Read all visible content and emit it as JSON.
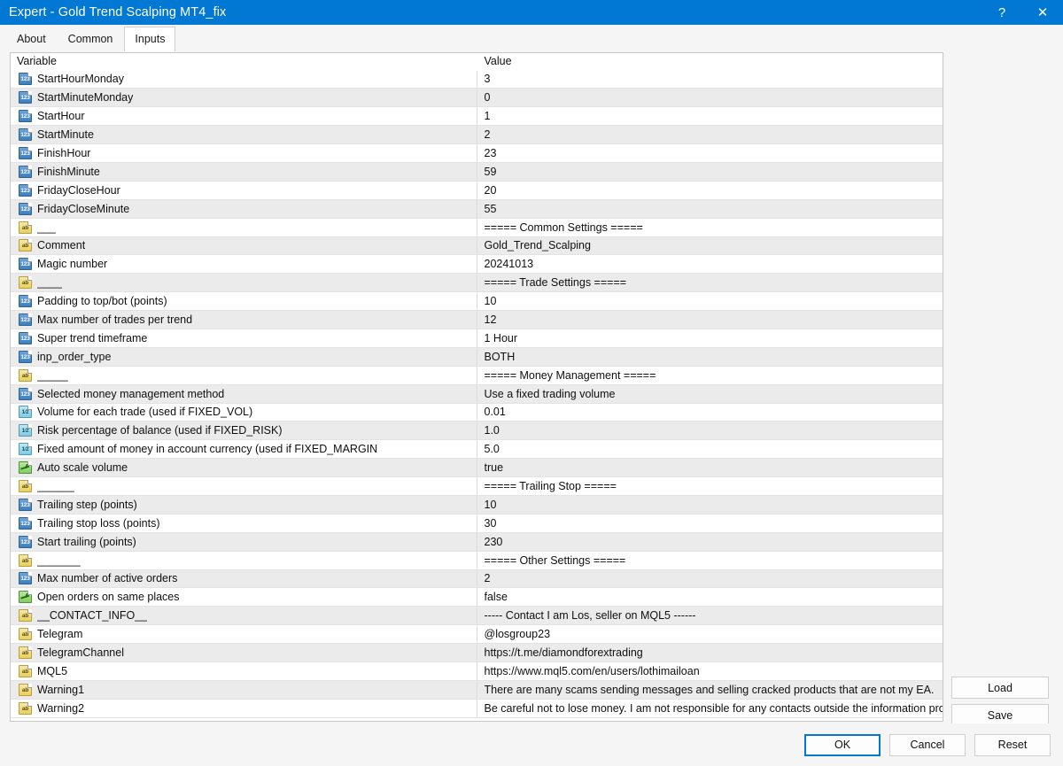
{
  "window": {
    "title": "Expert - Gold Trend Scalping MT4_fix",
    "help_label": "?",
    "close_label": "✕"
  },
  "tabs": [
    {
      "label": "About",
      "active": false
    },
    {
      "label": "Common",
      "active": false
    },
    {
      "label": "Inputs",
      "active": true
    }
  ],
  "table": {
    "headers": {
      "variable": "Variable",
      "value": "Value"
    },
    "rows": [
      {
        "type": "int",
        "variable": "StartHourMonday",
        "value": "3"
      },
      {
        "type": "int",
        "variable": "StartMinuteMonday",
        "value": "0"
      },
      {
        "type": "int",
        "variable": "StartHour",
        "value": "1"
      },
      {
        "type": "int",
        "variable": "StartMinute",
        "value": "2"
      },
      {
        "type": "int",
        "variable": "FinishHour",
        "value": "23"
      },
      {
        "type": "int",
        "variable": "FinishMinute",
        "value": "59"
      },
      {
        "type": "int",
        "variable": "FridayCloseHour",
        "value": "20"
      },
      {
        "type": "int",
        "variable": "FridayCloseMinute",
        "value": "55"
      },
      {
        "type": "str",
        "variable": "___",
        "value": "===== Common Settings ====="
      },
      {
        "type": "str",
        "variable": "Comment",
        "value": "Gold_Trend_Scalping"
      },
      {
        "type": "int",
        "variable": "Magic number",
        "value": "20241013"
      },
      {
        "type": "str",
        "variable": "____",
        "value": "===== Trade Settings ====="
      },
      {
        "type": "int",
        "variable": "Padding to top/bot (points)",
        "value": "10"
      },
      {
        "type": "int",
        "variable": "Max number of trades per trend",
        "value": "12"
      },
      {
        "type": "int",
        "variable": "Super trend timeframe",
        "value": "1 Hour"
      },
      {
        "type": "int",
        "variable": "inp_order_type",
        "value": "BOTH"
      },
      {
        "type": "str",
        "variable": "_____",
        "value": "===== Money Management ====="
      },
      {
        "type": "int",
        "variable": "Selected money management method",
        "value": "Use a fixed trading volume"
      },
      {
        "type": "dbl",
        "variable": "Volume for each trade (used if FIXED_VOL)",
        "value": "0.01"
      },
      {
        "type": "dbl",
        "variable": "Risk percentage of balance (used if FIXED_RISK)",
        "value": "1.0"
      },
      {
        "type": "dbl",
        "variable": "Fixed amount of money in account currency (used if FIXED_MARGIN",
        "value": "5.0"
      },
      {
        "type": "bool",
        "variable": "Auto scale volume",
        "value": "true"
      },
      {
        "type": "str",
        "variable": "______",
        "value": "===== Trailing Stop ====="
      },
      {
        "type": "int",
        "variable": "Trailing step (points)",
        "value": "10"
      },
      {
        "type": "int",
        "variable": "Trailing stop loss (points)",
        "value": "30"
      },
      {
        "type": "int",
        "variable": "Start trailing (points)",
        "value": "230"
      },
      {
        "type": "str",
        "variable": "_______",
        "value": "===== Other Settings  ====="
      },
      {
        "type": "int",
        "variable": "Max number of active orders",
        "value": "2"
      },
      {
        "type": "bool",
        "variable": "Open orders on same places",
        "value": "false"
      },
      {
        "type": "str",
        "variable": "__CONTACT_INFO__",
        "value": "----- Contact I am Los, seller on MQL5 ------"
      },
      {
        "type": "str",
        "variable": "Telegram",
        "value": "@losgroup23"
      },
      {
        "type": "str",
        "variable": "TelegramChannel",
        "value": "https://t.me/diamondforextrading"
      },
      {
        "type": "str",
        "variable": "MQL5",
        "value": "https://www.mql5.com/en/users/lothimailoan"
      },
      {
        "type": "str",
        "variable": "Warning1",
        "value": "There are many scams sending messages and selling cracked products that are not my EA."
      },
      {
        "type": "str",
        "variable": "Warning2",
        "value": "Be careful not to lose money. I am not responsible for any contacts outside the information provide..."
      }
    ]
  },
  "side_buttons": [
    {
      "label": "Load"
    },
    {
      "label": "Save"
    }
  ],
  "bottom_buttons": [
    {
      "label": "OK",
      "default": true
    },
    {
      "label": "Cancel",
      "default": false
    },
    {
      "label": "Reset",
      "default": false
    }
  ],
  "icon_glyphs": {
    "int": "123",
    "str": "ab",
    "dbl": "1⁄2",
    "bool": ""
  },
  "colors": {
    "titlebar": "#0078d4",
    "accent": "#0078d4",
    "row_alt": "#ebebeb",
    "grid_line": "#e3e3e3"
  }
}
